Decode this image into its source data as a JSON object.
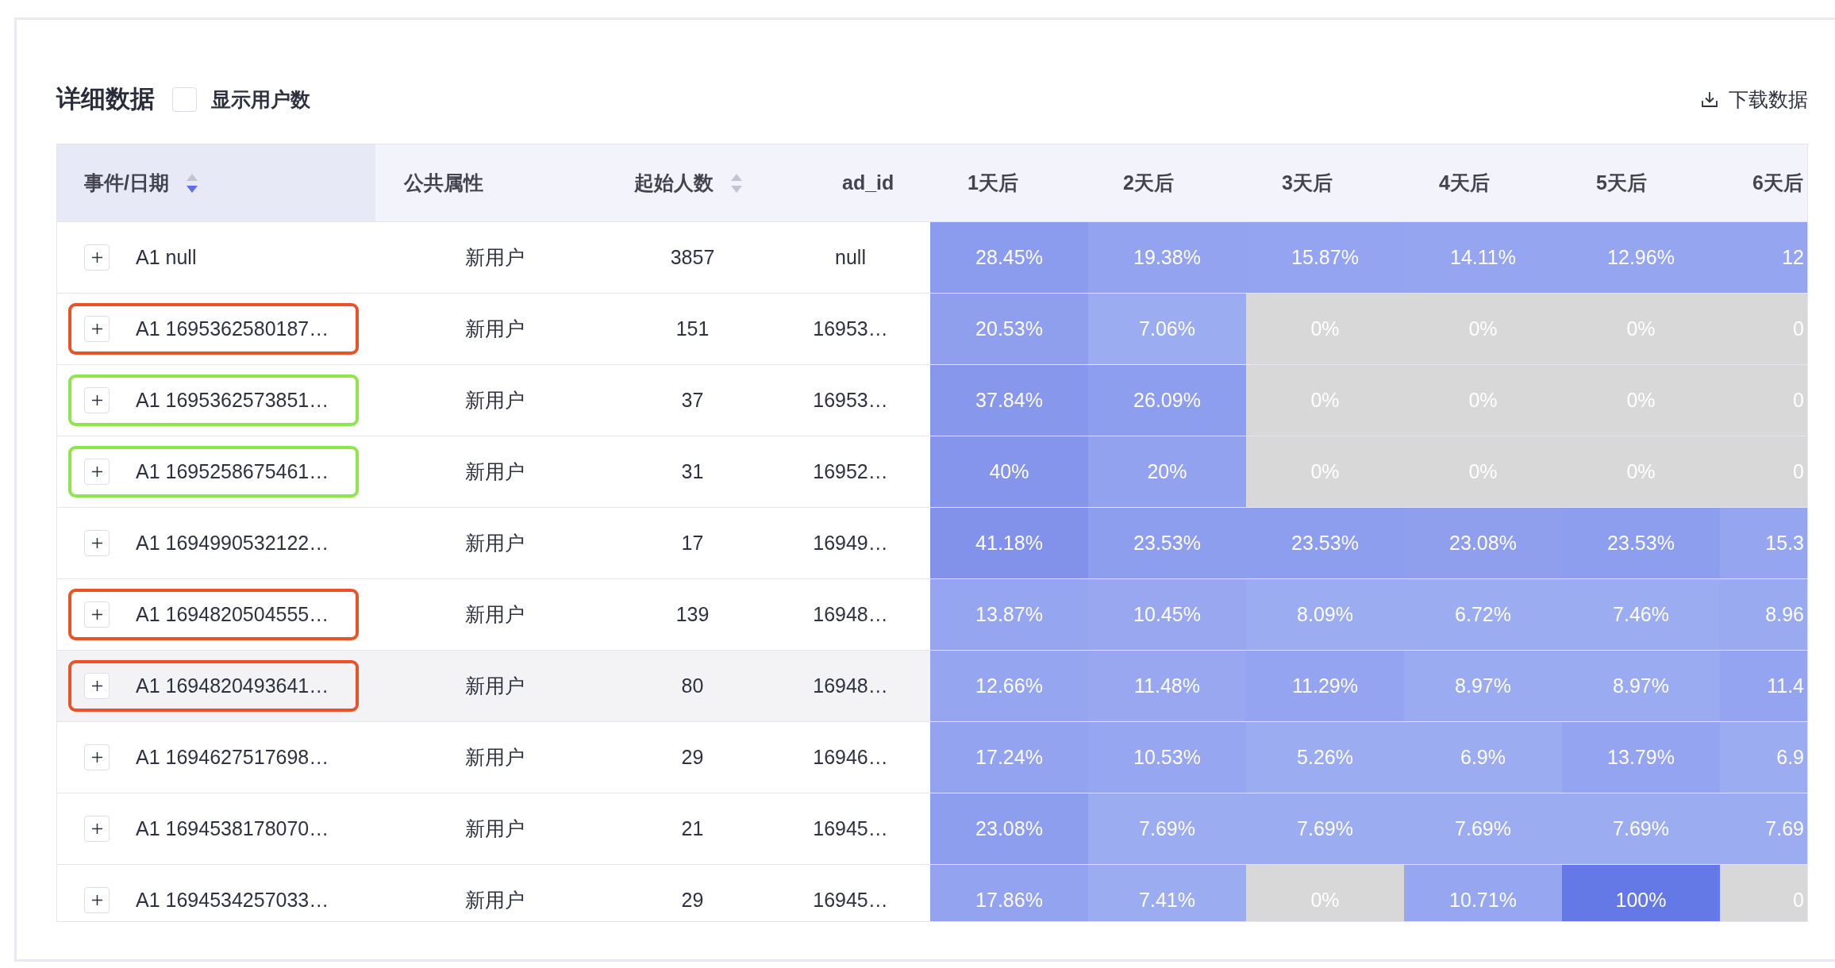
{
  "panel": {
    "title": "详细数据",
    "show_user_count": {
      "label": "显示用户数",
      "checked": false
    },
    "download": {
      "label": "下载数据"
    }
  },
  "table": {
    "columns": [
      {
        "label": "事件/日期",
        "sorted": true
      },
      {
        "label": "公共属性"
      },
      {
        "label": "起始人数",
        "sorted": false
      },
      {
        "label": "ad_id"
      },
      {
        "label": "1天后"
      },
      {
        "label": "2天后"
      },
      {
        "label": "3天后"
      },
      {
        "label": "4天后"
      },
      {
        "label": "5天后"
      },
      {
        "label": "6天后"
      }
    ],
    "rows": [
      {
        "event": "A1 null",
        "attribute": "新用户",
        "start_count": "3857",
        "ad_id": "null",
        "expanded": false,
        "hovered": false,
        "retention": [
          {
            "value": "28.45%",
            "color": "#8b9bee"
          },
          {
            "value": "19.38%",
            "color": "#94a3f0"
          },
          {
            "value": "15.87%",
            "color": "#95a4f0"
          },
          {
            "value": "14.11%",
            "color": "#96a5f0"
          },
          {
            "value": "12.96%",
            "color": "#96a5f0"
          },
          {
            "value": "12",
            "color": "#96a5f0"
          }
        ]
      },
      {
        "event": "A1 1695362580187…",
        "attribute": "新用户",
        "start_count": "151",
        "ad_id": "16953…",
        "expanded": false,
        "hovered": false,
        "highlight": {
          "color": "#ec5226"
        },
        "retention": [
          {
            "value": "20.53%",
            "color": "#8f9fee"
          },
          {
            "value": "7.06%",
            "color": "#9cacf1"
          },
          {
            "value": "0%",
            "color": "#d8d8d8"
          },
          {
            "value": "0%",
            "color": "#d8d8d8"
          },
          {
            "value": "0%",
            "color": "#d8d8d8"
          },
          {
            "value": "0",
            "color": "#d8d8d8"
          }
        ]
      },
      {
        "event": "A1 1695362573851…",
        "attribute": "新用户",
        "start_count": "37",
        "ad_id": "16953…",
        "expanded": false,
        "hovered": false,
        "highlight": {
          "color": "#8de64a"
        },
        "retention": [
          {
            "value": "37.84%",
            "color": "#8797ec"
          },
          {
            "value": "26.09%",
            "color": "#8e9eee"
          },
          {
            "value": "0%",
            "color": "#d8d8d8"
          },
          {
            "value": "0%",
            "color": "#d8d8d8"
          },
          {
            "value": "0%",
            "color": "#d8d8d8"
          },
          {
            "value": "0",
            "color": "#d8d8d8"
          }
        ]
      },
      {
        "event": "A1 1695258675461…",
        "attribute": "新用户",
        "start_count": "31",
        "ad_id": "16952…",
        "expanded": false,
        "hovered": false,
        "highlight": {
          "color": "#8de64a"
        },
        "retention": [
          {
            "value": "40%",
            "color": "#8595ec"
          },
          {
            "value": "20%",
            "color": "#93a2ef"
          },
          {
            "value": "0%",
            "color": "#d8d8d8"
          },
          {
            "value": "0%",
            "color": "#d8d8d8"
          },
          {
            "value": "0%",
            "color": "#d8d8d8"
          },
          {
            "value": "0",
            "color": "#d8d8d8"
          }
        ]
      },
      {
        "event": "A1 1694990532122…",
        "attribute": "新用户",
        "start_count": "17",
        "ad_id": "16949…",
        "expanded": false,
        "hovered": false,
        "retention": [
          {
            "value": "41.18%",
            "color": "#8292eb"
          },
          {
            "value": "23.53%",
            "color": "#8e9eee"
          },
          {
            "value": "23.53%",
            "color": "#8e9eee"
          },
          {
            "value": "23.08%",
            "color": "#8f9fee"
          },
          {
            "value": "23.53%",
            "color": "#8e9eee"
          },
          {
            "value": "15.3",
            "color": "#96a5f0"
          }
        ]
      },
      {
        "event": "A1 1694820504555…",
        "attribute": "新用户",
        "start_count": "139",
        "ad_id": "16948…",
        "expanded": false,
        "hovered": false,
        "highlight": {
          "color": "#ec5226"
        },
        "retention": [
          {
            "value": "13.87%",
            "color": "#96a5f0"
          },
          {
            "value": "10.45%",
            "color": "#98a7f0"
          },
          {
            "value": "8.09%",
            "color": "#9cacf1"
          },
          {
            "value": "6.72%",
            "color": "#9cacf1"
          },
          {
            "value": "7.46%",
            "color": "#9cacf1"
          },
          {
            "value": "8.96",
            "color": "#9aaaf1"
          }
        ]
      },
      {
        "event": "A1 1694820493641…",
        "attribute": "新用户",
        "start_count": "80",
        "ad_id": "16948…",
        "expanded": false,
        "hovered": true,
        "highlight": {
          "color": "#ec5226"
        },
        "retention": [
          {
            "value": "12.66%",
            "color": "#96a5f0"
          },
          {
            "value": "11.48%",
            "color": "#98a7f0"
          },
          {
            "value": "11.29%",
            "color": "#95a4f0"
          },
          {
            "value": "8.97%",
            "color": "#9babf1"
          },
          {
            "value": "8.97%",
            "color": "#9babf1"
          },
          {
            "value": "11.4",
            "color": "#95a4f0"
          }
        ]
      },
      {
        "event": "A1 1694627517698…",
        "attribute": "新用户",
        "start_count": "29",
        "ad_id": "16946…",
        "expanded": false,
        "hovered": false,
        "retention": [
          {
            "value": "17.24%",
            "color": "#94a3f0"
          },
          {
            "value": "10.53%",
            "color": "#97a6f0"
          },
          {
            "value": "5.26%",
            "color": "#9cacf1"
          },
          {
            "value": "6.9%",
            "color": "#9cacf1"
          },
          {
            "value": "13.79%",
            "color": "#95a4f0"
          },
          {
            "value": "6.9",
            "color": "#9cacf1"
          }
        ]
      },
      {
        "event": "A1 1694538178070…",
        "attribute": "新用户",
        "start_count": "21",
        "ad_id": "16945…",
        "expanded": false,
        "hovered": false,
        "retention": [
          {
            "value": "23.08%",
            "color": "#8e9eee"
          },
          {
            "value": "7.69%",
            "color": "#9cacf1"
          },
          {
            "value": "7.69%",
            "color": "#9cacf1"
          },
          {
            "value": "7.69%",
            "color": "#9cacf1"
          },
          {
            "value": "7.69%",
            "color": "#9cacf1"
          },
          {
            "value": "7.69",
            "color": "#9cacf1"
          }
        ]
      },
      {
        "event": "A1 1694534257033…",
        "attribute": "新用户",
        "start_count": "29",
        "ad_id": "16945…",
        "expanded": false,
        "hovered": false,
        "retention": [
          {
            "value": "17.86%",
            "color": "#94a3f0"
          },
          {
            "value": "7.41%",
            "color": "#9cacf1"
          },
          {
            "value": "0%",
            "color": "#d8d8d8"
          },
          {
            "value": "10.71%",
            "color": "#97a6f0"
          },
          {
            "value": "100%",
            "color": "#6479e6"
          },
          {
            "value": "0",
            "color": "#d8d8d8"
          }
        ]
      }
    ]
  }
}
